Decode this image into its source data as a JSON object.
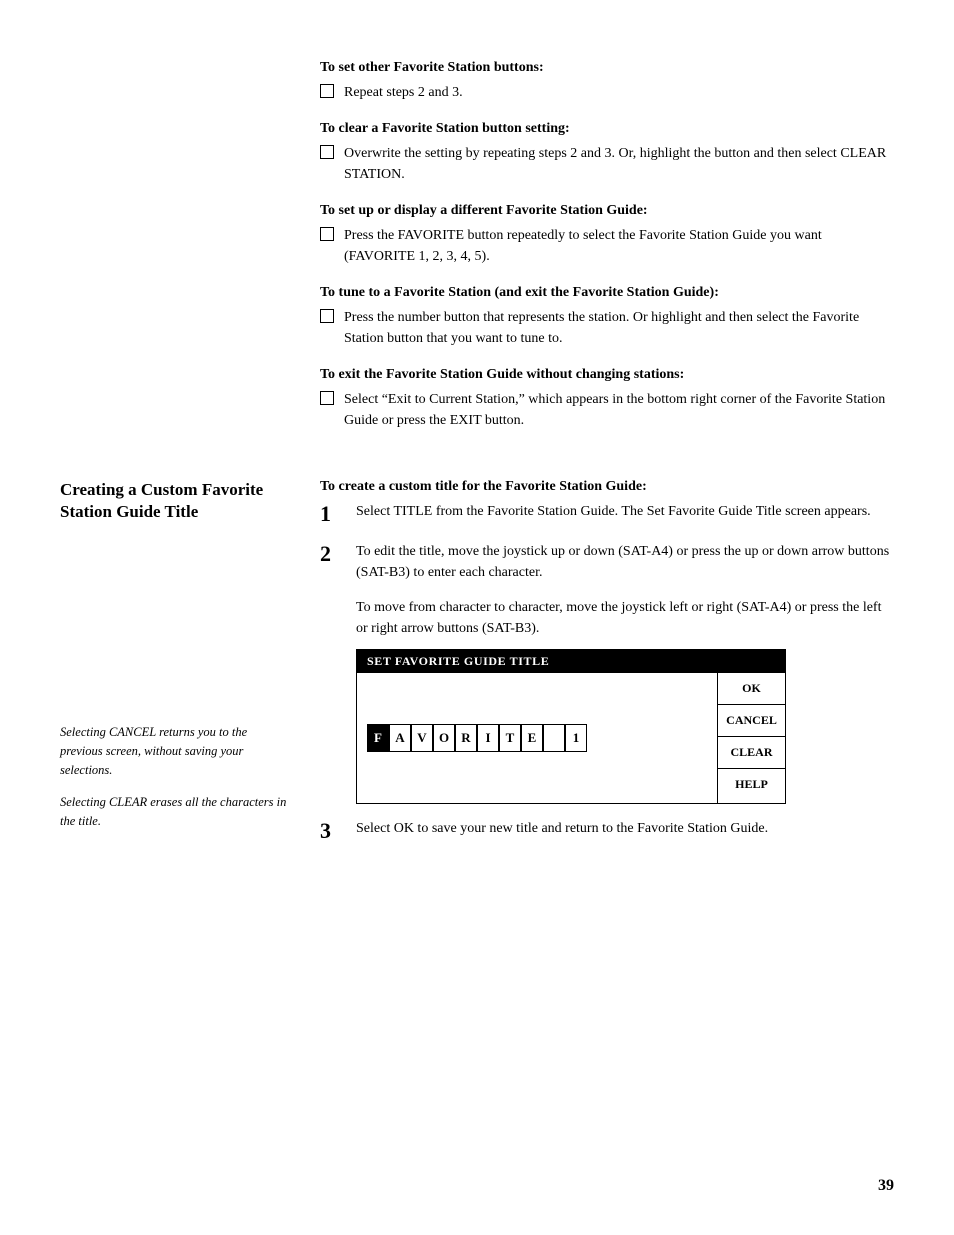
{
  "page": {
    "number": "39"
  },
  "top_section": {
    "blocks": [
      {
        "heading": "To set other Favorite Station buttons:",
        "bullets": [
          "Repeat steps 2 and 3."
        ]
      },
      {
        "heading": "To clear a Favorite Station button setting:",
        "bullets": [
          "Overwrite the setting by repeating steps 2 and 3. Or, highlight the button and then select CLEAR STATION."
        ]
      },
      {
        "heading": "To set up or display a different Favorite Station Guide:",
        "bullets": [
          "Press the FAVORITE button repeatedly to select the Favorite Station Guide you want (FAVORITE 1, 2, 3, 4, 5)."
        ]
      },
      {
        "heading": "To tune to a Favorite Station (and exit the Favorite Station Guide):",
        "bullets": [
          "Press the number button that represents the station. Or highlight and then select the Favorite Station button that you want to tune to."
        ]
      },
      {
        "heading": "To exit the Favorite Station Guide without changing stations:",
        "bullets": [
          "Select “Exit to Current Station,” which appears in the bottom right corner of the Favorite Station Guide or press the EXIT button."
        ]
      }
    ]
  },
  "sidebar": {
    "section_title_line1": "Creating a Custom Favorite",
    "section_title_line2": "Station Guide Title",
    "notes": [
      "Selecting CANCEL returns you to the previous screen, without saving your selections.",
      "Selecting CLEAR erases all the characters in the title."
    ]
  },
  "custom_section": {
    "heading": "To create a custom title for the Favorite Station Guide:",
    "steps": [
      {
        "number": "1",
        "text": "Select TITLE from the Favorite Station Guide. The Set Favorite Guide Title screen appears."
      },
      {
        "number": "2",
        "text": "To edit the title, move the joystick up or down (SAT-A4) or press the up or down arrow buttons (SAT-B3) to enter each character.",
        "sub_text": "To move from character to character, move the joystick left or right (SAT-A4) or press the left or right arrow buttons (SAT-B3)."
      },
      {
        "number": "3",
        "text": "Select OK to save your new title and return to the Favorite Station Guide."
      }
    ]
  },
  "favorite_box": {
    "title": "SET FAVORITE GUIDE TITLE",
    "chars": [
      "F",
      "A",
      "V",
      "O",
      "R",
      "I",
      "T",
      "E",
      "",
      "1"
    ],
    "active_index": 0,
    "buttons": [
      "OK",
      "CANCEL",
      "CLEAR",
      "HELP"
    ]
  }
}
